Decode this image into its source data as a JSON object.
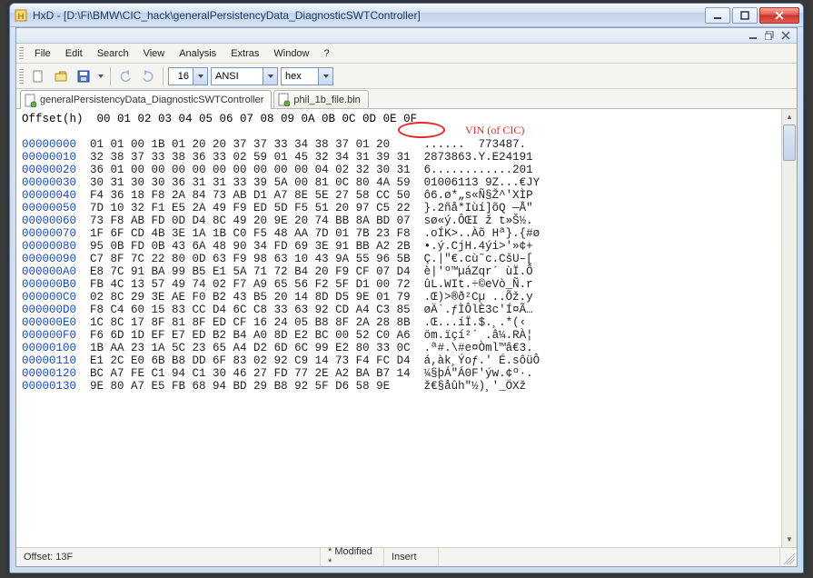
{
  "window": {
    "title": "HxD - [D:\\Fi\\BMW\\CIC_hack\\generalPersistencyData_DiagnosticSWTController]"
  },
  "menus": [
    "File",
    "Edit",
    "Search",
    "View",
    "Analysis",
    "Extras",
    "Window",
    "?"
  ],
  "toolbar": {
    "bytes_per_row": "16",
    "charset": "ANSI",
    "base": "hex"
  },
  "tabs": [
    {
      "label": "generalPersistencyData_DiagnosticSWTController",
      "active": true
    },
    {
      "label": "phil_1b_file.bin",
      "active": false
    }
  ],
  "annotation": {
    "label": "VIN (of CIC)"
  },
  "status": {
    "offset": "Offset: 13F",
    "modified": "* Modified *",
    "mode": "Insert"
  },
  "hex": {
    "header_left": "Offset(h)",
    "header_cols": "00 01 02 03 04 05 06 07 08 09 0A 0B 0C 0D 0E 0F",
    "rows": [
      {
        "off": "00000000",
        "bytes": "01 01 00 1B 01 20 20 37 37 33 34 38 37 01 20",
        "ascii": "......  773487.  "
      },
      {
        "off": "00000010",
        "bytes": "32 38 37 33 38 36 33 02 59 01 45 32 34 31 39 31",
        "ascii": "2873863.Y.E24191"
      },
      {
        "off": "00000020",
        "bytes": "36 01 00 00 00 00 00 00 00 00 00 04 02 32 30 31",
        "ascii": "6............201"
      },
      {
        "off": "00000030",
        "bytes": "30 31 30 30 36 31 31 33 39 5A 00 81 0C 80 4A 59",
        "ascii": "01006113 9Z...€JY"
      },
      {
        "off": "00000040",
        "bytes": "F4 36 18 F8 2A 84 73 AB D1 A7 8E 5E 27 58 CC 50",
        "ascii": "ô6.ø*„s«Ñ§Ž^'XÌP"
      },
      {
        "off": "00000050",
        "bytes": "7D 10 32 F1 E5 2A 49 F9 ED 5D F5 51 20 97 C5 22",
        "ascii": "}.2ñå*Iùí]õQ —Å\""
      },
      {
        "off": "00000060",
        "bytes": "73 F8 AB FD 0D D4 8C 49 20 9E 20 74 BB 8A BD 07",
        "ascii": "sø«ý.ÔŒI ž t»Š½."
      },
      {
        "off": "00000070",
        "bytes": "1F 6F CD 4B 3E 1A 1B C0 F5 48 AA 7D 01 7B 23 F8",
        "ascii": ".oÍK>..Àõ Hª}.{#ø"
      },
      {
        "off": "00000080",
        "bytes": "95 0B FD 0B 43 6A 48 90 34 FD 69 3E 91 BB A2 2B",
        "ascii": "•.ý.CjH.4ýi>'»¢+"
      },
      {
        "off": "00000090",
        "bytes": "C7 8F 7C 22 80 0D 63 F9 98 63 10 43 9A 55 96 5B",
        "ascii": "Ç.|\"€.cù˜c.CšU–["
      },
      {
        "off": "000000A0",
        "bytes": "E8 7C 91 BA 99 B5 E1 5A 71 72 B4 20 F9 CF 07 D4",
        "ascii": "è|'º™µáZqr´ ùÏ.Ô"
      },
      {
        "off": "000000B0",
        "bytes": "FB 4C 13 57 49 74 02 F7 A9 65 56 F2 5F D1 00 72",
        "ascii": "ûL.WIt.÷©eVò_Ñ.r"
      },
      {
        "off": "000000C0",
        "bytes": "02 8C 29 3E AE F0 B2 43 B5 20 14 8D D5 9E 01 79",
        "ascii": ".Œ)>®ð²Cµ ..Õž.y"
      },
      {
        "off": "000000D0",
        "bytes": "F8 C4 60 15 83 CC D4 6C C8 33 63 92 CD A4 C3 85",
        "ascii": "øÄ`.ƒÌÔlÈ3c'Í¤Ã…"
      },
      {
        "off": "000000E0",
        "bytes": "1C 8C 17 8F 81 8F ED CF 16 24 05 B8 8F 2A 28 8B",
        "ascii": ".Œ...íÏ.$.¸.*(‹"
      },
      {
        "off": "000000F0",
        "bytes": "F6 6D 1D EF E7 ED B2 B4 A0 8D E2 BC 00 52 C0 A6",
        "ascii": "öm.ïçí²´ .â¼.RÀ¦"
      },
      {
        "off": "00000100",
        "bytes": "1B AA 23 1A 5C 23 65 A4 D2 6D 6C 99 E2 80 33 0C",
        "ascii": ".ª#.\\#e¤Òml™â€3."
      },
      {
        "off": "00000110",
        "bytes": "E1 2C E0 6B B8 DD 6F 83 02 92 C9 14 73 F4 FC D4",
        "ascii": "á,àk¸Ýoƒ.' É.sôüÔ"
      },
      {
        "off": "00000120",
        "bytes": "BC A7 FE C1 94 C1 30 46 27 FD 77 2E A2 BA B7 14",
        "ascii": "¼§þÁ\"Á0F'ýw.¢º·."
      },
      {
        "off": "00000130",
        "bytes": "9E 80 A7 E5 FB 68 94 BD 29 B8 92 5F D6 58 9E",
        "ascii": "ž€§åûh\"½)¸'_ÖXž"
      }
    ]
  },
  "chart_data": {
    "type": "table",
    "note": "hex dump; rows listed under hex.rows"
  }
}
